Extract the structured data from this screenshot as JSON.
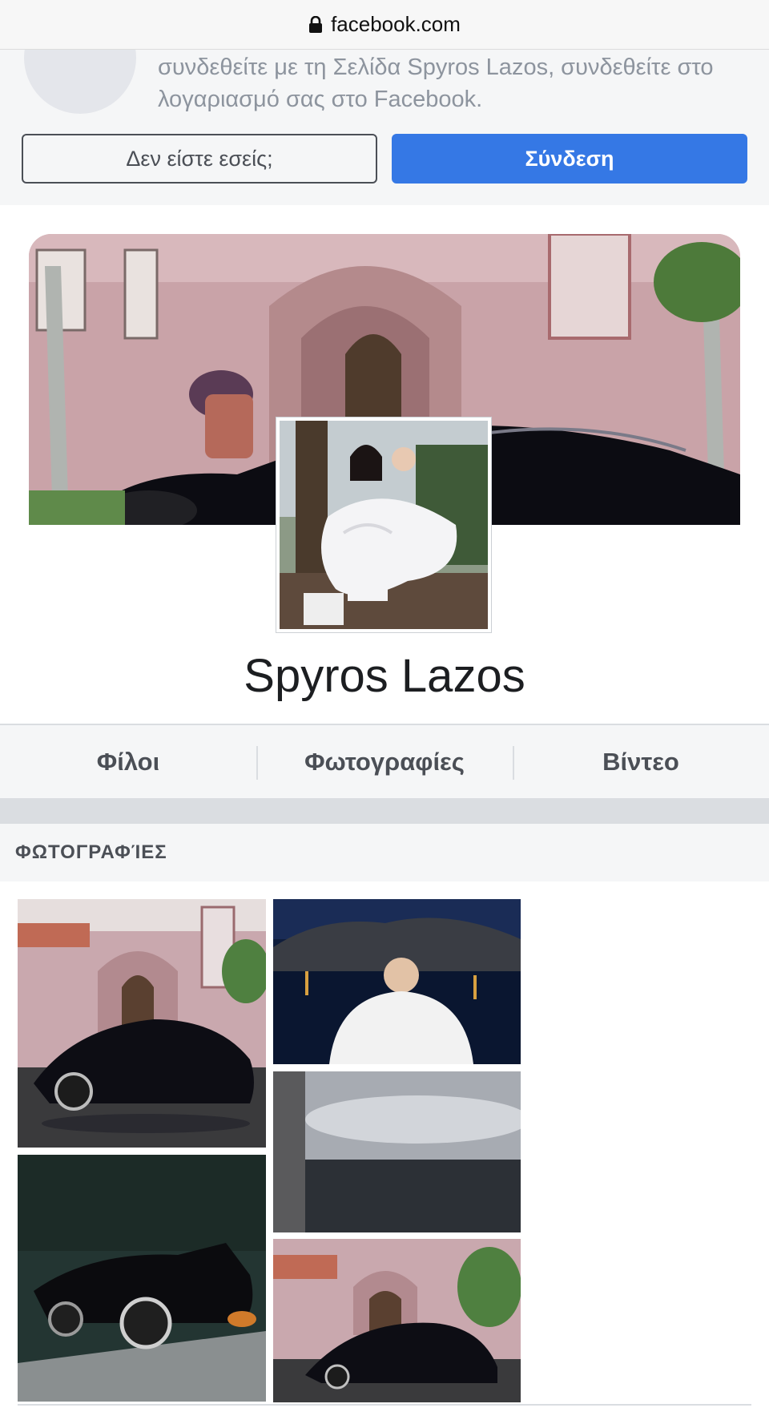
{
  "browser": {
    "url": "facebook.com"
  },
  "notice": {
    "message": "συνδεθείτε με τη Σελίδα Spyros Lazos, συνδεθείτε στο λογαριασμό σας στο Facebook.",
    "not_you_label": "Δεν είστε εσείς;",
    "login_label": "Σύνδεση"
  },
  "profile": {
    "name": "Spyros Lazos"
  },
  "tabs": [
    {
      "label": "Φίλοι"
    },
    {
      "label": "Φωτογραφίες"
    },
    {
      "label": "Βίντεο"
    }
  ],
  "photos_section": {
    "title": "ΦΩΤΟΓΡΑΦΊΕΣ"
  },
  "colors": {
    "accent": "#3578e5",
    "header_bg": "#f5f6f7",
    "text_dark": "#1c1e21",
    "text_muted": "#8d949e"
  }
}
